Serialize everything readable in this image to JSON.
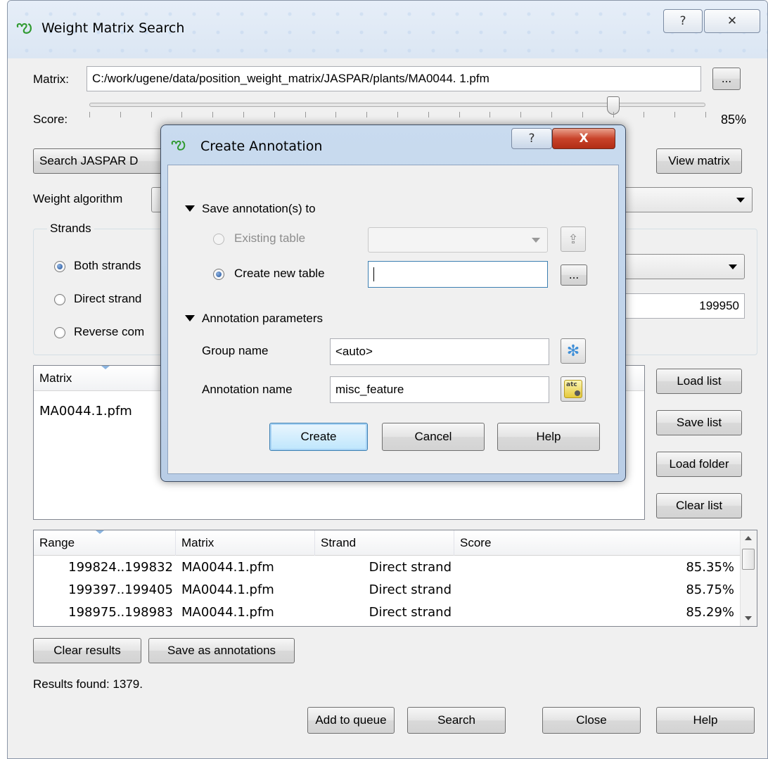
{
  "window": {
    "title": "Weight Matrix Search",
    "help_glyph": "?",
    "close_glyph": "✕"
  },
  "matrix": {
    "label": "Matrix:",
    "path": "C:/work/ugene/data/position_weight_matrix/JASPAR/plants/MA0044. 1.pfm",
    "browse_label": "..."
  },
  "score": {
    "label": "Score:",
    "value": 0.85,
    "value_text": "85%"
  },
  "buttons_row": {
    "search_jaspar_label": "Search JASPAR D",
    "view_matrix_label": "View matrix"
  },
  "weight_algorithm": {
    "label": "Weight algorithm"
  },
  "strands": {
    "title": "Strands",
    "options": [
      {
        "label": "Both strands",
        "selected": true
      },
      {
        "label": "Direct strand",
        "selected": false
      },
      {
        "label": "Reverse com",
        "selected": false
      }
    ],
    "range_end": "199950"
  },
  "matrix_list": {
    "header": "Matrix",
    "items": [
      "MA0044.1.pfm"
    ],
    "load_list": "Load list",
    "save_list": "Save list",
    "load_folder": "Load folder",
    "clear_list": "Clear list"
  },
  "results": {
    "headers": [
      "Range",
      "Matrix",
      "Strand",
      "Score"
    ],
    "rows": [
      {
        "range": "199824..199832",
        "matrix": "MA0044.1.pfm",
        "strand": "Direct strand",
        "score": "85.35%"
      },
      {
        "range": "199397..199405",
        "matrix": "MA0044.1.pfm",
        "strand": "Direct strand",
        "score": "85.75%"
      },
      {
        "range": "198975..198983",
        "matrix": "MA0044.1.pfm",
        "strand": "Direct strand",
        "score": "85.29%"
      }
    ],
    "clear_results": "Clear results",
    "save_as_annotations": "Save as annotations",
    "found_text": "Results found: 1379."
  },
  "bottom_buttons": {
    "add_to_queue": "Add to queue",
    "search": "Search",
    "close": "Close",
    "help": "Help"
  },
  "dialog": {
    "title": "Create Annotation",
    "help_glyph": "?",
    "close_glyph": "X",
    "save_section": "Save annotation(s) to",
    "existing_table": "Existing table",
    "create_new_table": "Create new table",
    "new_table_value": "",
    "browse_label": "...",
    "params_section": "Annotation parameters",
    "group_name_label": "Group name",
    "group_name_value": "<auto>",
    "annotation_name_label": "Annotation name",
    "annotation_name_value": "misc_feature",
    "auto_icon_text": "atc",
    "create": "Create",
    "cancel": "Cancel",
    "help": "Help"
  }
}
